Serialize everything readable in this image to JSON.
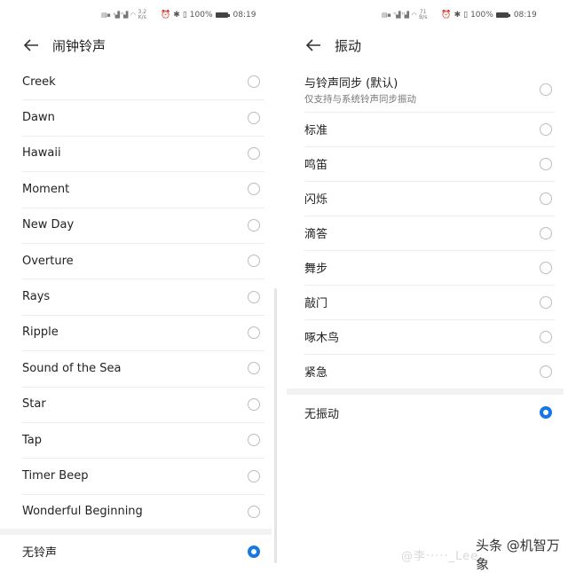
{
  "status_bar_left": {
    "net_speed_value": "3.2",
    "net_speed_unit": "K/s",
    "battery_text": "100%",
    "time": "08:19"
  },
  "status_bar_right": {
    "net_speed_value": "71",
    "net_speed_unit": "B/s",
    "battery_text": "100%",
    "time": "08:19"
  },
  "left_screen": {
    "title": "闹钟铃声",
    "items": [
      {
        "label": "Creek",
        "selected": false
      },
      {
        "label": "Dawn",
        "selected": false
      },
      {
        "label": "Hawaii",
        "selected": false
      },
      {
        "label": "Moment",
        "selected": false
      },
      {
        "label": "New Day",
        "selected": false
      },
      {
        "label": "Overture",
        "selected": false
      },
      {
        "label": "Rays",
        "selected": false
      },
      {
        "label": "Ripple",
        "selected": false
      },
      {
        "label": "Sound of the Sea",
        "selected": false
      },
      {
        "label": "Star",
        "selected": false
      },
      {
        "label": "Tap",
        "selected": false
      },
      {
        "label": "Timer Beep",
        "selected": false
      },
      {
        "label": "Wonderful Beginning",
        "selected": false
      }
    ],
    "none_item": {
      "label": "无铃声",
      "selected": true
    }
  },
  "right_screen": {
    "title": "振动",
    "items": [
      {
        "label": "与铃声同步 (默认)",
        "sublabel": "仅支持与系统铃声同步振动",
        "selected": false
      },
      {
        "label": "标准",
        "selected": false
      },
      {
        "label": "鸣笛",
        "selected": false
      },
      {
        "label": "闪烁",
        "selected": false
      },
      {
        "label": "滴答",
        "selected": false
      },
      {
        "label": "舞步",
        "selected": false
      },
      {
        "label": "敲门",
        "selected": false
      },
      {
        "label": "啄木鸟",
        "selected": false
      },
      {
        "label": "紧急",
        "selected": false
      }
    ],
    "none_item": {
      "label": "无振动",
      "selected": true
    }
  },
  "watermark": {
    "text": "头条 @机智万象",
    "ghost_text": "@李·····_Lee"
  },
  "colors": {
    "accent": "#1677e5",
    "divider": "#ececec",
    "radio_border": "#bdbdbd"
  }
}
